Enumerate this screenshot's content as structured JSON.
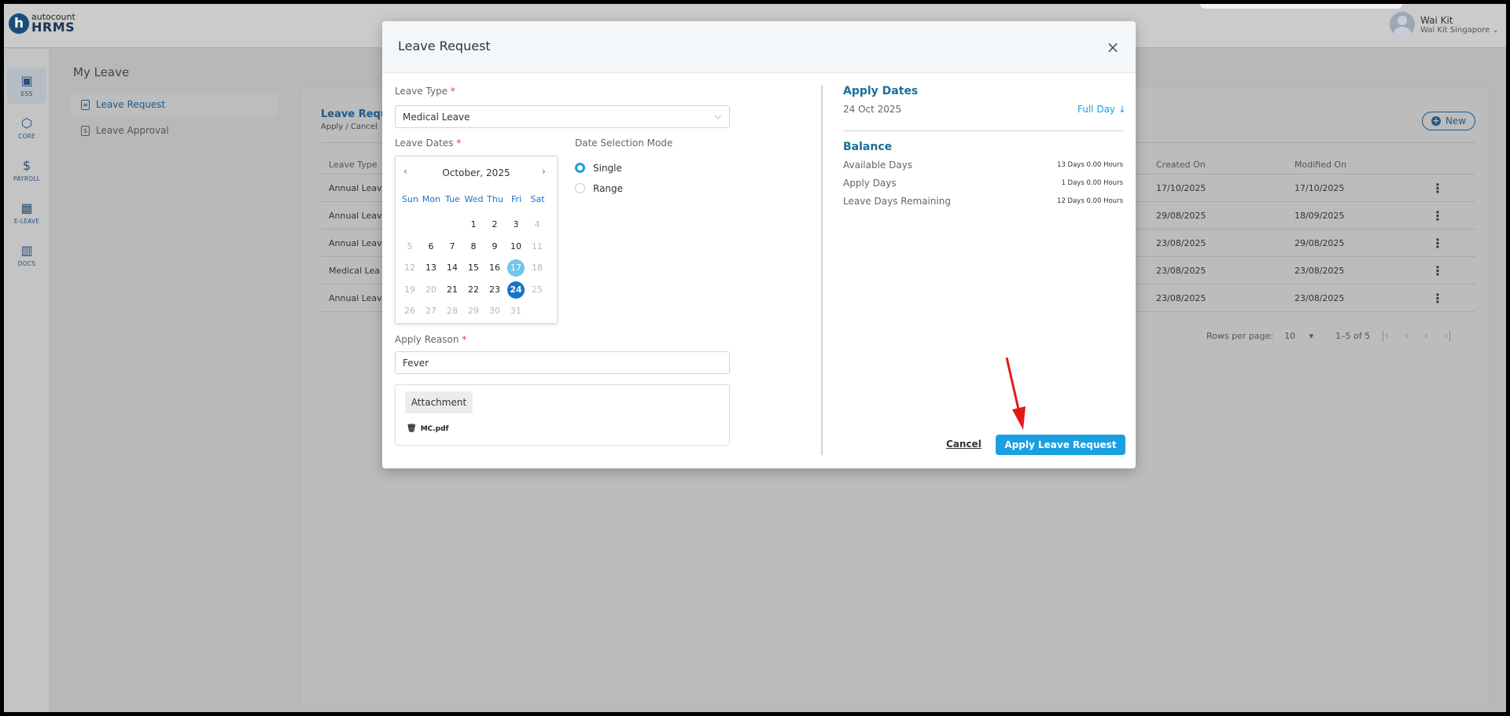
{
  "app": {
    "logo_top": "autocount",
    "logo_bottom": "HRMS",
    "user_name": "Wai Kit",
    "user_company": "Wai Kit Singapore"
  },
  "sidebar": {
    "items": [
      {
        "label": "ESS",
        "icon": "person-card-icon"
      },
      {
        "label": "CORE",
        "icon": "cube-icon"
      },
      {
        "label": "PAYROLL",
        "icon": "dollar-icon"
      },
      {
        "label": "E-LEAVE",
        "icon": "calendar-icon"
      },
      {
        "label": "DOCS",
        "icon": "chart-doc-icon"
      }
    ]
  },
  "page": {
    "title": "My Leave",
    "subnav": [
      "Leave Request",
      "Leave Approval"
    ],
    "card_title": "Leave Requ",
    "card_sub": "Apply / Cancel",
    "new_label": "New",
    "columns": {
      "type": "Leave Type",
      "created": "Created On",
      "modified": "Modified On"
    },
    "rows": [
      {
        "type": "Annual Leav",
        "created": "17/10/2025",
        "modified": "17/10/2025"
      },
      {
        "type": "Annual Leav",
        "created": "29/08/2025",
        "modified": "18/09/2025"
      },
      {
        "type": "Annual Leav",
        "created": "23/08/2025",
        "modified": "29/08/2025"
      },
      {
        "type": "Medical Lea",
        "created": "23/08/2025",
        "modified": "23/08/2025"
      },
      {
        "type": "Annual Leav",
        "created": "23/08/2025",
        "modified": "23/08/2025"
      }
    ],
    "rows_per_page_label": "Rows per page:",
    "rows_per_page": "10",
    "range": "1–5 of 5"
  },
  "modal": {
    "title": "Leave Request",
    "leave_type_label": "Leave Type",
    "leave_type_value": "Medical Leave",
    "leave_dates_label": "Leave Dates",
    "calendar": {
      "month": "October, 2025",
      "dow": [
        "Sun",
        "Mon",
        "Tue",
        "Wed",
        "Thu",
        "Fri",
        "Sat"
      ],
      "first_weekday": 3,
      "days_in_month": 31,
      "today": 17,
      "selected": 24,
      "muted_days": [
        4,
        5,
        11,
        12,
        18,
        19,
        20,
        25,
        26,
        27,
        28,
        29,
        30,
        31
      ]
    },
    "mode_label": "Date Selection Mode",
    "mode_single": "Single",
    "mode_range": "Range",
    "mode_selected": "Single",
    "reason_label": "Apply Reason",
    "reason_value": "Fever",
    "attachment_label": "Attachment",
    "attachment_file": "MC.pdf",
    "apply_dates_title": "Apply Dates",
    "apply_date": "24 Oct 2025",
    "day_type": "Full Day",
    "balance_title": "Balance",
    "balance": [
      {
        "label": "Available Days",
        "value": "13 Days 0.00 Hours"
      },
      {
        "label": "Apply Days",
        "value": "1 Days 0.00 Hours"
      },
      {
        "label": "Leave Days Remaining",
        "value": "12 Days 0.00 Hours"
      }
    ],
    "cancel_label": "Cancel",
    "apply_label": "Apply Leave Request"
  },
  "colors": {
    "accent": "#1a9fe0",
    "calendar_today": "#6fc6f0",
    "calendar_selected": "#1475c9",
    "section_title": "#1b6e97",
    "required": "#e53935",
    "annotation_arrow": "#e81818"
  }
}
